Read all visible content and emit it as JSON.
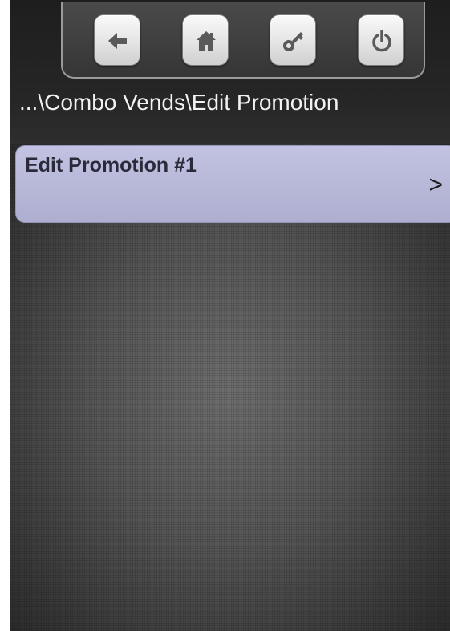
{
  "toolbar": {
    "buttons": [
      {
        "id": "back",
        "icon": "arrow-left-icon"
      },
      {
        "id": "home",
        "icon": "home-icon"
      },
      {
        "id": "key",
        "icon": "key-icon"
      },
      {
        "id": "power",
        "icon": "power-icon"
      }
    ]
  },
  "breadcrumb": {
    "text": "...\\Combo Vends\\Edit Promotion"
  },
  "menu": {
    "items": [
      {
        "label": "Edit Promotion #1",
        "chevron": ">"
      }
    ]
  },
  "colors": {
    "menu_item_background": "#b7b7d8",
    "header_background": "#232323",
    "screen_background": "#555555",
    "button_face": "#e4e4e4",
    "icon_color": "#5a5a5a"
  }
}
